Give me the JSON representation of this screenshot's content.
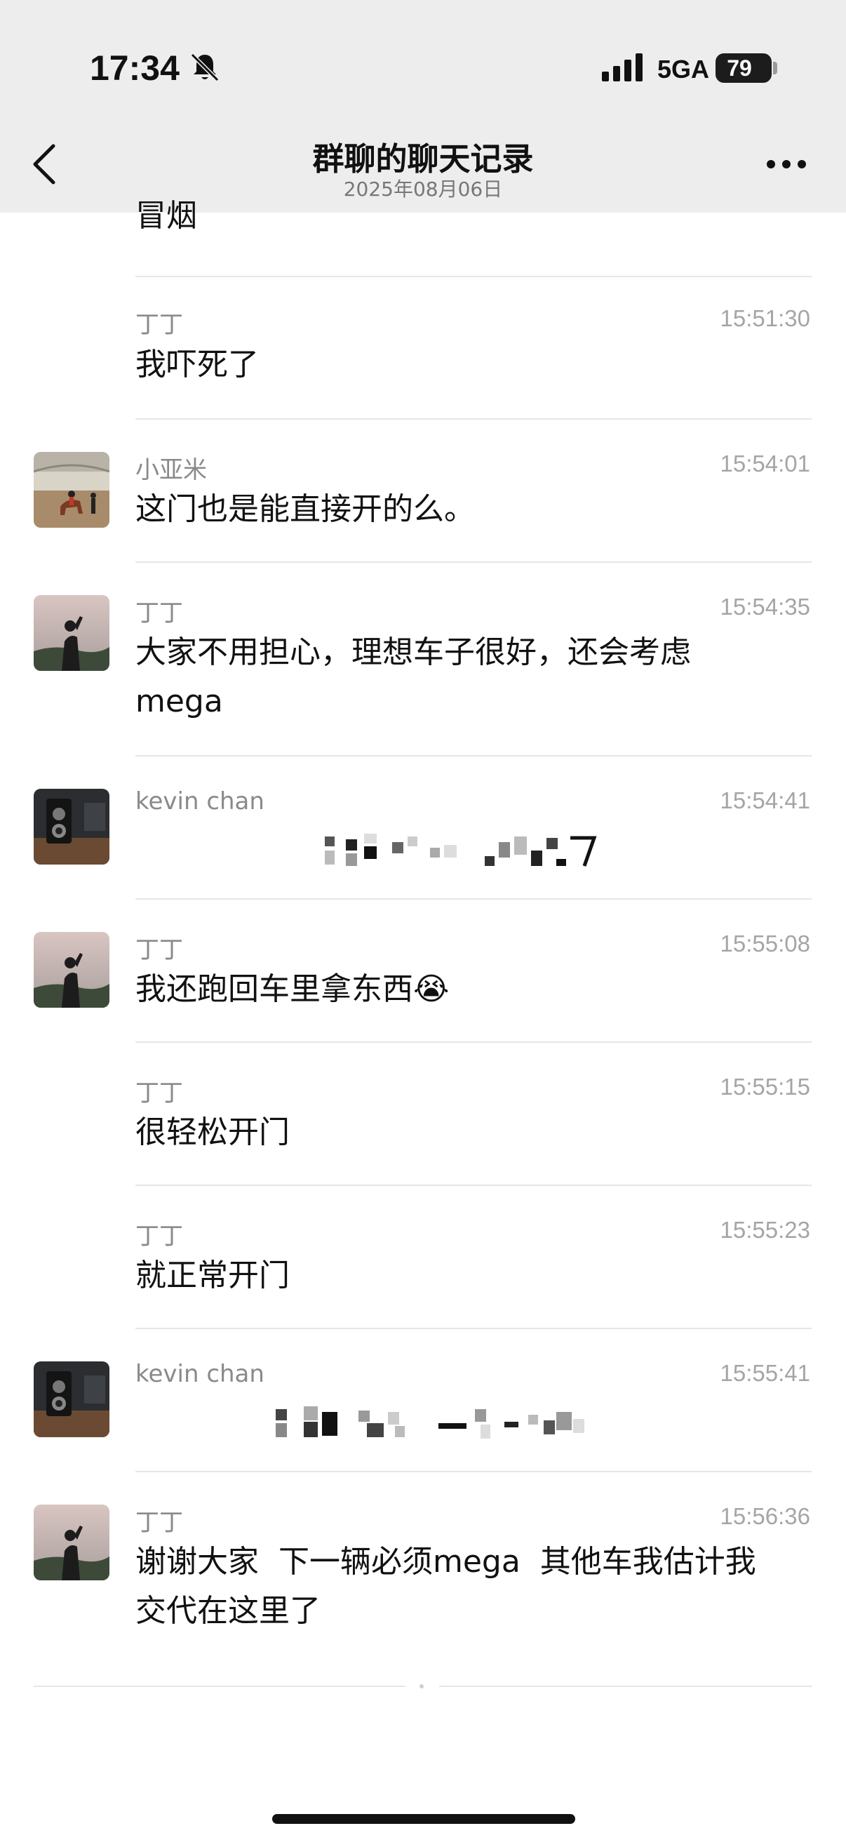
{
  "status_bar": {
    "time": "17:34",
    "network": "5GA",
    "battery_level": "79"
  },
  "nav": {
    "title": "群聊的聊天记录",
    "subtitle": "2025年08月06日"
  },
  "messages": [
    {
      "sender": "",
      "time": "",
      "text": "冒烟",
      "avatar": "none"
    },
    {
      "sender": "丁丁",
      "time": "15:51:30",
      "text": "我吓死了",
      "avatar": "none"
    },
    {
      "sender": "小亚米",
      "time": "15:54:01",
      "text": "这门也是能直接开的么。",
      "avatar": "horse-riding-photo"
    },
    {
      "sender": "丁丁",
      "time": "15:54:35",
      "text": "大家不用担心，理想车子很好，还会考虑",
      "text2": "mega",
      "avatar": "silhouette-sunset"
    },
    {
      "sender": "kevin chan",
      "time": "15:54:41",
      "text": "",
      "avatar": "vintage-camera",
      "pixelated": true
    },
    {
      "sender": "丁丁",
      "time": "15:55:08",
      "text": "我还跑回车里拿东西",
      "emoji": "😭",
      "avatar": "silhouette-sunset"
    },
    {
      "sender": "丁丁",
      "time": "15:55:15",
      "text": "很轻松开门",
      "avatar": "none"
    },
    {
      "sender": "丁丁",
      "time": "15:55:23",
      "text": "就正常开门",
      "avatar": "none"
    },
    {
      "sender": "kevin chan",
      "time": "15:55:41",
      "text": "",
      "avatar": "vintage-camera",
      "pixelated": true
    },
    {
      "sender": "丁丁",
      "time": "15:56:36",
      "text": "谢谢大家  下一辆必须mega  其他车我估计我",
      "text2": "交代在这里了",
      "avatar": "silhouette-sunset"
    }
  ]
}
